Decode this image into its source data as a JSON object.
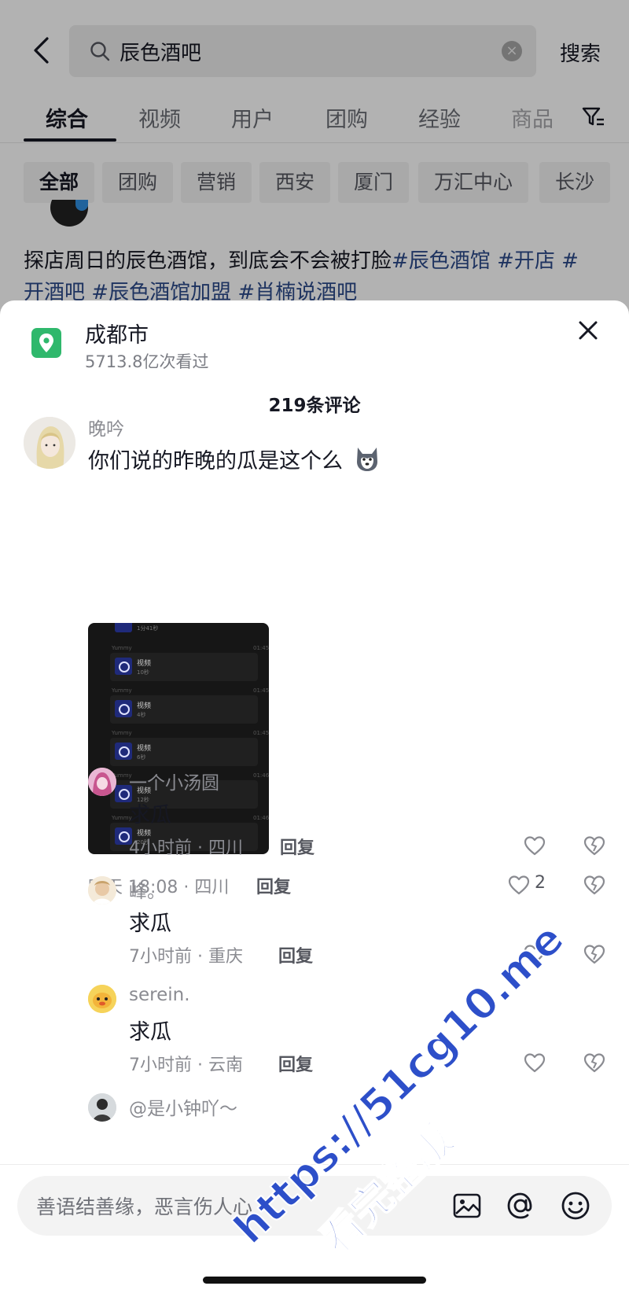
{
  "search": {
    "query": "辰色酒吧",
    "button": "搜索"
  },
  "tabs": [
    "综合",
    "视频",
    "用户",
    "团购",
    "经验",
    "商品"
  ],
  "chips": [
    "全部",
    "团购",
    "营销",
    "西安",
    "厦门",
    "万汇中心",
    "长沙"
  ],
  "post": {
    "text": "探店周日的辰色酒馆，到底会不会被打脸",
    "tags_line1": "#辰色酒馆 #开店 #",
    "line2_tag_a": "开酒吧",
    "line2_tag_b": "#辰色酒馆加盟",
    "line2_tag_c": "#肖楠说酒吧"
  },
  "sheet": {
    "location_title": "成都市",
    "location_views": "5713.8亿次看过",
    "comment_count": "219条评论",
    "input_placeholder": "善语结善缘，恶言伤人心"
  },
  "main_comment": {
    "user": "晚吟",
    "text": "你们说的昨晚的瓜是这个么",
    "meta": "昨天 18:08 · 四川",
    "reply": "回复",
    "likes": "2",
    "screenshot": {
      "top_duration": "1分41秒",
      "rows": [
        {
          "name": "Yummy",
          "label": "视频",
          "duration": "10秒",
          "time": "01:45"
        },
        {
          "name": "Yummy",
          "label": "视频",
          "duration": "4秒",
          "time": "01:45"
        },
        {
          "name": "Yummy",
          "label": "视频",
          "duration": "6秒",
          "time": "01:45"
        },
        {
          "name": "Yummy",
          "label": "视频",
          "duration": "12秒",
          "time": "01:46"
        },
        {
          "name": "Yummy",
          "label": "视频",
          "duration": "20秒",
          "time": "01:46"
        }
      ]
    }
  },
  "replies": [
    {
      "user": "一个小汤圆",
      "text": "求瓜",
      "meta": "4小时前 · 四川",
      "reply": "回复"
    },
    {
      "user": "峰。",
      "text": "求瓜",
      "meta": "7小时前 · 重庆",
      "reply": "回复"
    },
    {
      "user": "serein.",
      "text": "求瓜",
      "meta": "7小时前 · 云南",
      "reply": "回复"
    },
    {
      "user": "@是小钟吖～"
    }
  ],
  "watermark": {
    "line1": "https://51cg10.me",
    "line2": "看完整版"
  },
  "colors": {
    "location_icon": "#2fb86c",
    "hashtag": "#2c4a8a",
    "watermark": "#2d4fc9"
  }
}
